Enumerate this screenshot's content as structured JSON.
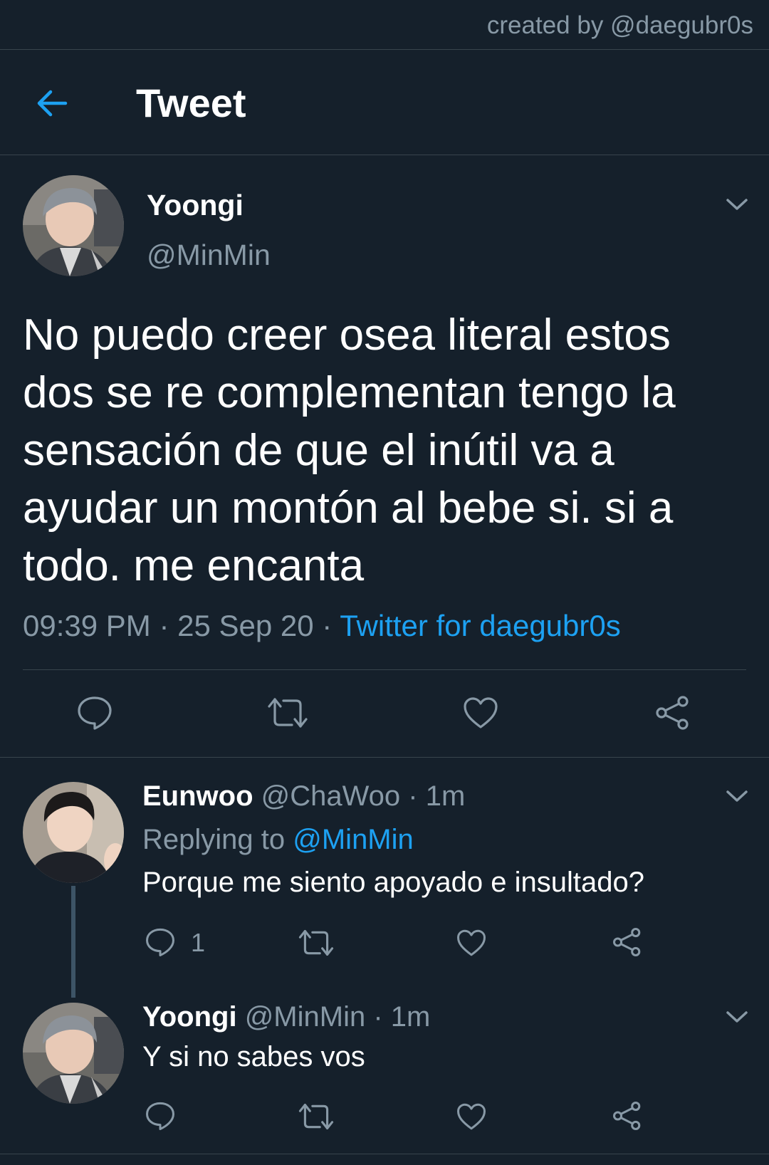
{
  "watermark": "created by @daegubr0s",
  "header": {
    "title": "Tweet",
    "back_icon": "arrow-left-icon"
  },
  "colors": {
    "background": "#15202b",
    "accent": "#1da1f2",
    "muted": "#8899a6",
    "divider": "#38444d"
  },
  "tweet": {
    "name": "Yoongi",
    "handle": "@MinMin",
    "text": "No puedo creer osea literal estos dos se re complementan tengo la sensación de que el inútil va a ayudar un montón al bebe si. si a todo. me encanta",
    "time": "09:39 PM",
    "date": "25 Sep 20",
    "separator": " · ",
    "source": "Twitter for daegubr0s",
    "actions": [
      "reply-icon",
      "retweet-icon",
      "like-icon",
      "share-icon"
    ]
  },
  "replies": [
    {
      "name": "Eunwoo",
      "handle": "@ChaWoo",
      "time": "· 1m",
      "replying_prefix": "Replying to",
      "replying_to": "@MinMin",
      "text": "Porque me siento apoyado e insultado?",
      "reply_count": "1"
    },
    {
      "name": "Yoongi",
      "handle": "@MinMin",
      "time": "· 1m",
      "text": "Y si no sabes vos"
    }
  ]
}
